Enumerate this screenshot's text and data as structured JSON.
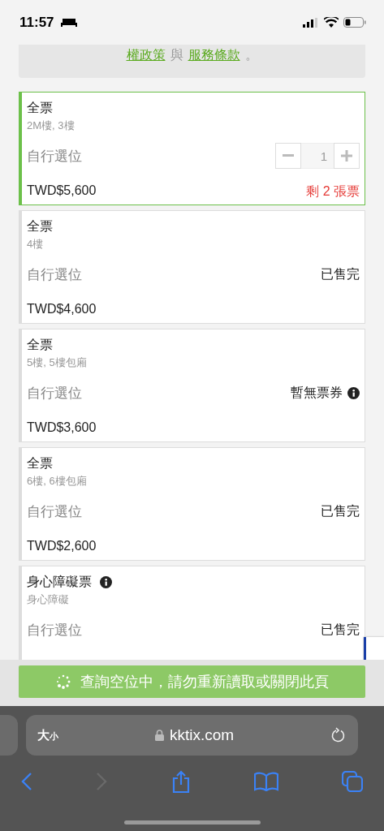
{
  "status_bar": {
    "time": "11:57"
  },
  "notice": {
    "link_1": "權政策",
    "joiner": "與",
    "link_2": "服務條款",
    "end": "。"
  },
  "tickets": [
    {
      "kind": "stepper",
      "selected": true,
      "name": "全票",
      "info": false,
      "area": "2M樓, 3樓",
      "seat": "自行選位",
      "quantity": "1",
      "price": "TWD$5,600",
      "remaining": "剩 2 張票"
    },
    {
      "kind": "status",
      "selected": false,
      "name": "全票",
      "info": false,
      "area": "4樓",
      "seat": "自行選位",
      "status": "已售完",
      "status_info": false,
      "price": "TWD$4,600"
    },
    {
      "kind": "status",
      "selected": false,
      "name": "全票",
      "info": false,
      "area": "5樓, 5樓包廂",
      "seat": "自行選位",
      "status": "暫無票券",
      "status_info": true,
      "price": "TWD$3,600"
    },
    {
      "kind": "status",
      "selected": false,
      "name": "全票",
      "info": false,
      "area": "6樓, 6樓包廂",
      "seat": "自行選位",
      "status": "已售完",
      "status_info": false,
      "price": "TWD$2,600"
    },
    {
      "kind": "status",
      "selected": false,
      "name": "身心障礙票",
      "info": true,
      "area": "身心障礙",
      "seat": "自行選位",
      "status": "已售完",
      "status_info": false
    }
  ],
  "loading_bar": {
    "text": "查詢空位中，請勿重新讀取或關閉此頁"
  },
  "browser": {
    "text_size": "大",
    "text_size_small": "小",
    "url": "kktix.com",
    "forward_disabled": true
  }
}
